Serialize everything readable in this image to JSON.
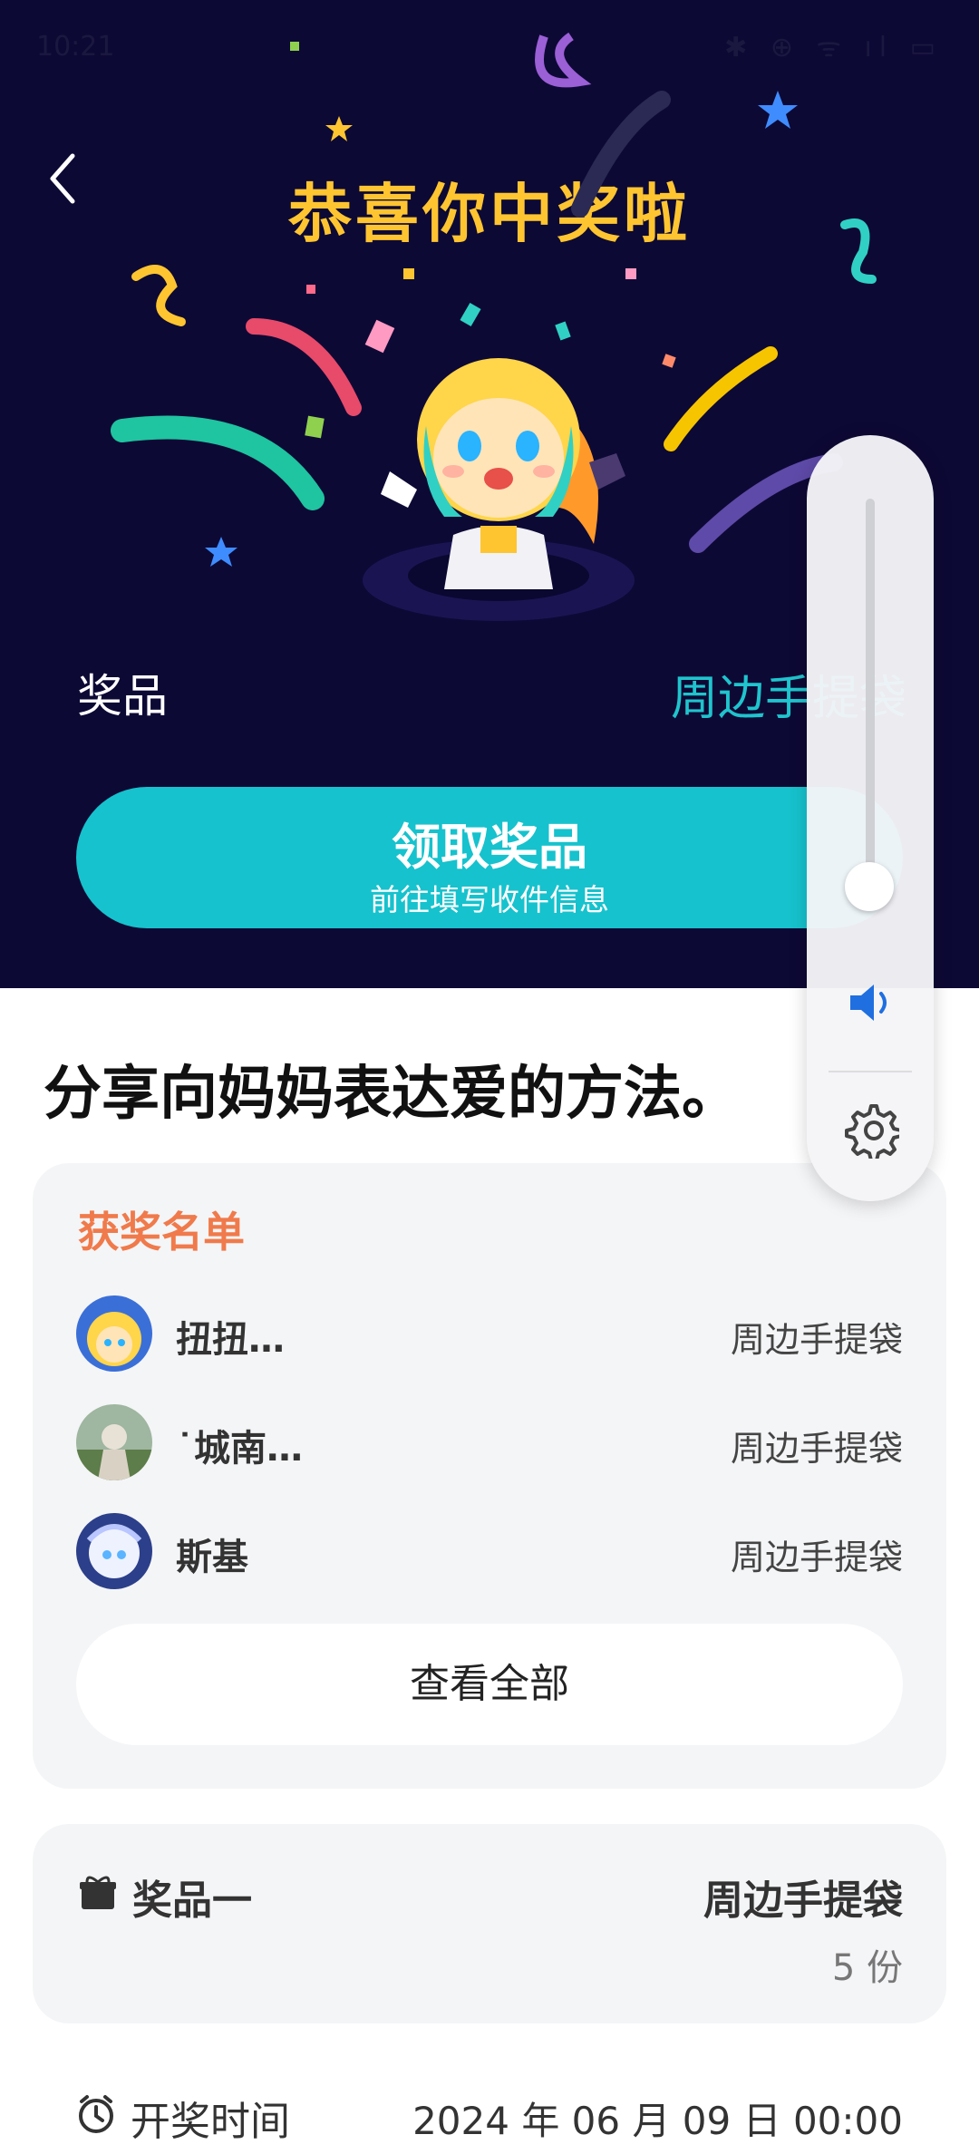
{
  "status_bar": {
    "time": "10:21",
    "icons": "✱ ⊕ ᯤ ıl ▭"
  },
  "hero": {
    "back_icon": "chevron-left-icon",
    "title": "恭喜你中奖啦",
    "prize_label": "奖品",
    "prize_name": "周边手提袋",
    "claim_button": {
      "main": "领取奖品",
      "sub": "前往填写收件信息"
    },
    "colors": {
      "background": "#0d0935",
      "title": "#ffc531",
      "accent": "#16c2cd"
    }
  },
  "share_text": "分享向妈妈表达爱的方法。",
  "winners": {
    "title": "获奖名单",
    "items": [
      {
        "name": "扭扭…",
        "prize": "周边手提袋"
      },
      {
        "name": "˙城南…",
        "prize": "周边手提袋"
      },
      {
        "name": "斯基",
        "prize": "周边手提袋"
      }
    ],
    "view_all": "查看全部"
  },
  "prize_one": {
    "label": "奖品一",
    "name": "周边手提袋",
    "quantity": "5 份"
  },
  "draw_time": {
    "label": "开奖时间",
    "value": "2024 年 06 月 09 日 00:00"
  },
  "volume_panel": {
    "level": 0.05,
    "speaker_icon": "speaker-icon",
    "settings_icon": "gear-icon"
  }
}
